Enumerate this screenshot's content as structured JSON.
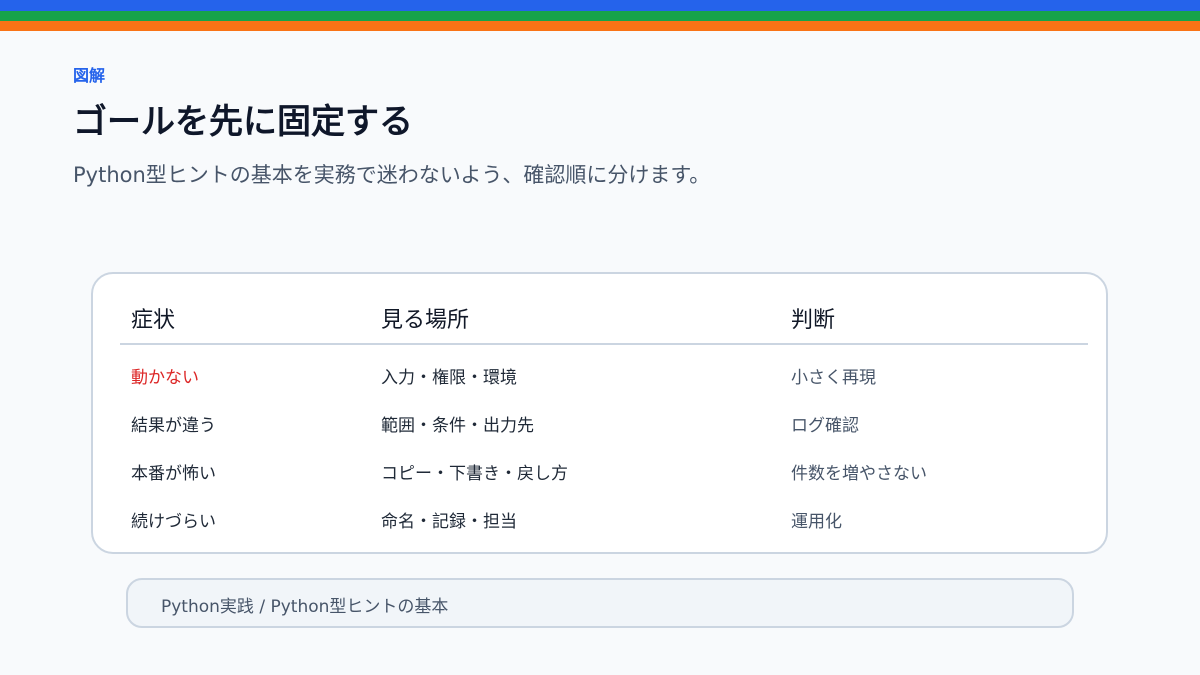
{
  "colors": {
    "stripe_blue": "#2563eb",
    "stripe_green": "#16a34a",
    "stripe_orange": "#f97316",
    "accent": "#2563eb",
    "alert": "#dc2626"
  },
  "header": {
    "eyebrow": "図解",
    "title": "ゴールを先に固定する",
    "subtitle": "Python型ヒントの基本を実務で迷わないよう、確認順に分けます。"
  },
  "table": {
    "headers": [
      "症状",
      "見る場所",
      "判断"
    ],
    "rows": [
      [
        "動かない",
        "入力・権限・環境",
        "小さく再現"
      ],
      [
        "結果が違う",
        "範囲・条件・出力先",
        "ログ確認"
      ],
      [
        "本番が怖い",
        "コピー・下書き・戻し方",
        "件数を増やさない"
      ],
      [
        "続けづらい",
        "命名・記録・担当",
        "運用化"
      ]
    ]
  },
  "footer": {
    "breadcrumb": "Python実践 / Python型ヒントの基本"
  }
}
